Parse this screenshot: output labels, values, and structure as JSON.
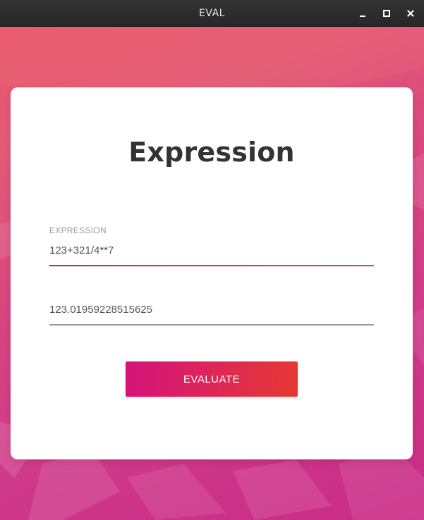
{
  "window": {
    "title": "EVAL"
  },
  "card": {
    "title": "Expression",
    "expression_field": {
      "label": "EXPRESSION",
      "value": "123+321/4**7"
    },
    "result_field": {
      "value": "123.01959228515625"
    },
    "evaluate_button_label": "EVALUATE"
  },
  "colors": {
    "background_top": "#e9566f",
    "background_bottom": "#c92b86",
    "button_start": "#d6127c",
    "button_end": "#e53935",
    "active_underline": "#a82a9a"
  }
}
